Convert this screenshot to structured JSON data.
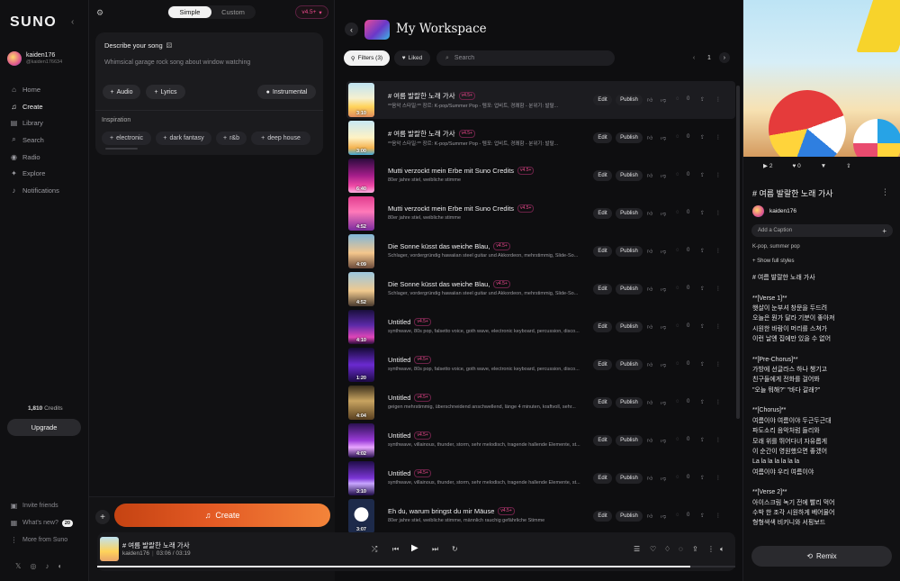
{
  "nav": {
    "logo": "SUNO",
    "user_name": "kaiden176",
    "user_handle": "@kaiden176634",
    "items": [
      {
        "label": "Home",
        "icon": "home-icon"
      },
      {
        "label": "Create",
        "icon": "music-note-icon"
      },
      {
        "label": "Library",
        "icon": "library-icon"
      },
      {
        "label": "Search",
        "icon": "search-icon"
      },
      {
        "label": "Radio",
        "icon": "radio-icon"
      },
      {
        "label": "Explore",
        "icon": "compass-icon"
      },
      {
        "label": "Notifications",
        "icon": "bell-icon"
      }
    ],
    "credits_value": "1,810",
    "credits_label": "Credits",
    "upgrade": "Upgrade",
    "invite": "Invite friends",
    "whats_new": "What's new?",
    "whats_new_count": "20",
    "more": "More from Suno"
  },
  "create": {
    "mode_simple": "Simple",
    "mode_custom": "Custom",
    "version": "v4.5+",
    "describe_label": "Describe your song",
    "describe_placeholder": "Whimsical garage rock song about window watching",
    "audio": "Audio",
    "lyrics": "Lyrics",
    "instrumental": "Instrumental",
    "inspiration": "Inspiration",
    "tags": [
      "electronic",
      "dark fantasy",
      "r&b",
      "deep house"
    ],
    "create_button": "Create"
  },
  "workspace": {
    "title": "My Workspace",
    "filters": "Filters (3)",
    "liked": "Liked",
    "search_placeholder": "Search",
    "page": "1",
    "edit_label": "Edit",
    "publish_label": "Publish",
    "zero": "0",
    "songs": [
      {
        "title": "# 여름 발랄한 노래 가사",
        "badge": "v4.5+",
        "desc": "**음악 스타일:** 장르: K-pop/Summer Pop - 템포: 업비트, 경쾌함 - 분위기: 발랄...",
        "duration": "3:10"
      },
      {
        "title": "# 여름 발랄한 노래 가사",
        "badge": "v4.5+",
        "desc": "**음악 스타일:** 장르: K-pop/Summer Pop - 템포: 업비트, 경쾌함 - 분위기: 발랄...",
        "duration": "3:00"
      },
      {
        "title": "Mutti verzockt mein Erbe mit Suno Credits",
        "badge": "v4.5+",
        "desc": "80er jahre stiel, weibliche stimme",
        "duration": "6:40"
      },
      {
        "title": "Mutti verzockt mein Erbe mit Suno Credits",
        "badge": "v4.5+",
        "desc": "80er jahre stiel, weibliche stimme",
        "duration": "4:52"
      },
      {
        "title": "Die Sonne küsst das weiche Blau,",
        "badge": "v4.5+",
        "desc": "Schlager, vordergründig hawaiian steel guitar und Akkordeon, mehrstimmig, Slide-So...",
        "duration": "4:09"
      },
      {
        "title": "Die Sonne küsst das weiche Blau,",
        "badge": "v4.5+",
        "desc": "Schlager, vordergründig hawaiian steel guitar und Akkordeon, mehrstimmig, Slide-So...",
        "duration": "4:52"
      },
      {
        "title": "Untitled",
        "badge": "v4.5+",
        "desc": "synthwave, 80s pop, falsetto voice, goth wave, electronic keyboard, percussion, disco...",
        "duration": "4:10"
      },
      {
        "title": "Untitled",
        "badge": "v4.5+",
        "desc": "synthwave, 80s pop, falsetto voice, goth wave, electronic keyboard, percussion, disco...",
        "duration": "1:20"
      },
      {
        "title": "Untitled",
        "badge": "v4.5+",
        "desc": "geigen mehrstimmig, überschneidend anschwellend, länge 4 minuten, kraftvoll, sehr...",
        "duration": "4:04"
      },
      {
        "title": "Untitled",
        "badge": "v4.5+",
        "desc": "synthwave, villainous, thunder, storm, sehr melodisch, tragende hallende Elemente, st...",
        "duration": "4:02"
      },
      {
        "title": "Untitled",
        "badge": "v4.5+",
        "desc": "synthwave, villainous, thunder, storm, sehr melodisch, tragende hallende Elemente, st...",
        "duration": "3:10"
      },
      {
        "title": "Eh du, warum bringst du mir Mäuse",
        "badge": "v4.5+",
        "desc": "80er jahre stiel, weibliche stimme, männlich rauchig gefährliche Stimme",
        "duration": "3:07"
      }
    ]
  },
  "player": {
    "title": "# 여름 발랄한 노래 가사",
    "artist": "kaiden176",
    "time": "03:06 / 03:19",
    "progress": 0.93
  },
  "detail": {
    "plays": "2",
    "likes": "0",
    "title": "# 여름 발랄한 노래 가사",
    "user": "kaiden176",
    "caption_placeholder": "Add a Caption",
    "style": "K-pop, summer pop",
    "show_full": "+ Show full styles",
    "lyrics": "# 여름 발랄한 노래 가사\n\n**[Verse 1]**\n햇살이 눈부셔 창문을 두드려\n오늘은 뭔가 달라 기분이 좋아져\n시원한 바람이 머리를 스쳐가\n이런 날엔 집에만 있을 수 없어\n\n**[Pre-Chorus]**\n가방에 선글라스 하나 챙기고\n친구들에게 전화를 걸어봐\n\"오늘 뭐해?\" \"바다 갈래?\"\n\n**[Chorus]**\n여름이야 여름이야 두근두근대\n파도소리 음악처럼 들리와\n모래 위를 뛰어다녀 자유롭게\n이 순간이 영원했으면 좋겠어\nLa la la la la la la\n여름이야 우리 여름이야\n\n**[Verse 2]**\n아이스크림 녹기 전에 빨리 먹어\n수박 한 조각 시원하게 베어물어\n형형색색 비키니와 서핑보드",
    "remix": "Remix"
  }
}
